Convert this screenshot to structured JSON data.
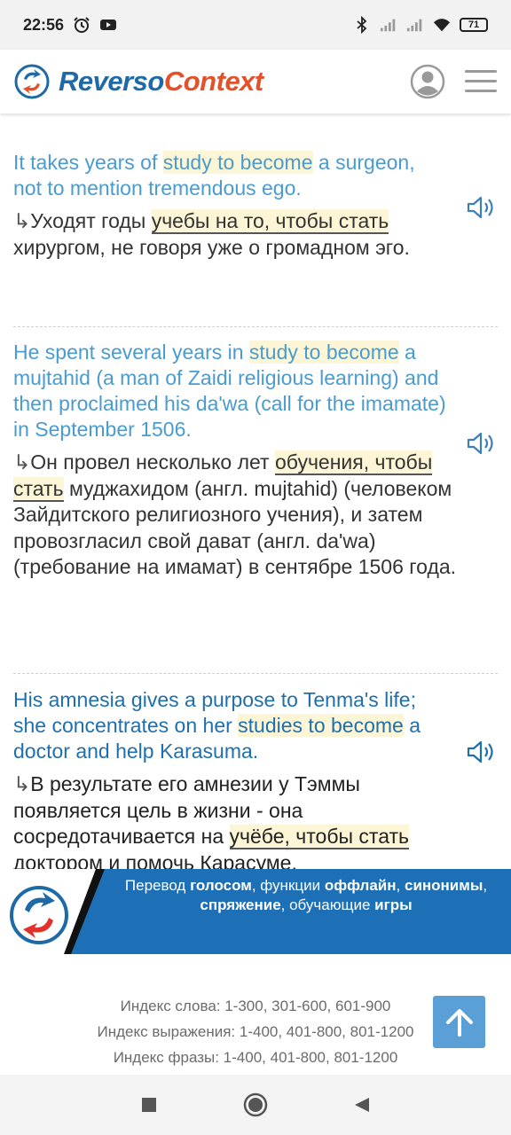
{
  "status_bar": {
    "time": "22:56",
    "battery": "71",
    "icons": [
      "alarm-icon",
      "youtube-icon",
      "bluetooth-icon",
      "signal-icon",
      "signal-icon",
      "wifi-icon",
      "battery-icon"
    ]
  },
  "header": {
    "logo_part1": "Reverso",
    "logo_part2": "Context",
    "icons": [
      "reverso-logo-icon",
      "profile-icon",
      "menu-icon"
    ]
  },
  "examples": [
    {
      "src": [
        {
          "t": "It takes years of ",
          "h": false
        },
        {
          "t": "study to become",
          "h": true
        },
        {
          "t": " a surgeon, not to mention tremendous ego.",
          "h": false
        }
      ],
      "src_color": "#4a9bd0",
      "trg": [
        {
          "t": "Уходят годы ",
          "h": false
        },
        {
          "t": "учебы на то, чтобы стать",
          "h": true
        },
        {
          "t": " хирургом, не говоря уже о громадном эго.",
          "h": false
        }
      ]
    },
    {
      "src": [
        {
          "t": "He spent several years in ",
          "h": false
        },
        {
          "t": "study to become",
          "h": true
        },
        {
          "t": " a mujtahid (a man of Zaidi religious learning) and then proclaimed his da'wa (call for the imamate) in September 1506.",
          "h": false
        }
      ],
      "src_color": "#4a9bd0",
      "trg": [
        {
          "t": "Он провел несколько лет ",
          "h": false
        },
        {
          "t": "обучения, чтобы стать",
          "h": true
        },
        {
          "t": " муджахидом (англ. mujtahid) (человеком Зайдитского религиозного учения), и затем провозгласил свой дават (англ. da'wa) (требование на имамат) в сентябре 1506 года.",
          "h": false
        }
      ]
    },
    {
      "src": [
        {
          "t": "His amnesia gives a purpose to Tenma's life; she concentrates on her ",
          "h": false
        },
        {
          "t": "studies to become",
          "h": true
        },
        {
          "t": " a doctor and help Karasuma.",
          "h": false
        }
      ],
      "src_color": "#1f6fae",
      "trg": [
        {
          "t": "В результате его амнезии у Тэммы появляется цель в жизни - она сосредотачивается на ",
          "h": false
        },
        {
          "t": "учёбе, чтобы стать",
          "h": true
        },
        {
          "t": " доктором и помочь Карасуме.",
          "h": false
        }
      ]
    }
  ],
  "promo": {
    "parts": [
      {
        "t": "Перевод ",
        "b": false
      },
      {
        "t": "голосом",
        "b": true
      },
      {
        "t": ", функции ",
        "b": false
      },
      {
        "t": "оффлайн",
        "b": true
      },
      {
        "t": ", ",
        "b": false
      },
      {
        "t": "синонимы",
        "b": true
      },
      {
        "t": ", ",
        "b": false
      },
      {
        "t": "спряжение",
        "b": true
      },
      {
        "t": ", обучающие ",
        "b": false
      },
      {
        "t": "игры",
        "b": true
      }
    ]
  },
  "footer": {
    "word_index": "Индекс слова: 1-300, 301-600, 601-900",
    "expression_index": "Индекс выражения: 1-400, 401-800, 801-1200",
    "phrase_index": "Индекс фразы: 1-400, 401-800, 801-1200"
  },
  "colors": {
    "brand_blue": "#1e6aa8",
    "brand_orange": "#e2512a",
    "highlight": "#fdf6d6",
    "promo_bg": "#1d6fb6",
    "to_top_bg": "#5aa0d6"
  }
}
